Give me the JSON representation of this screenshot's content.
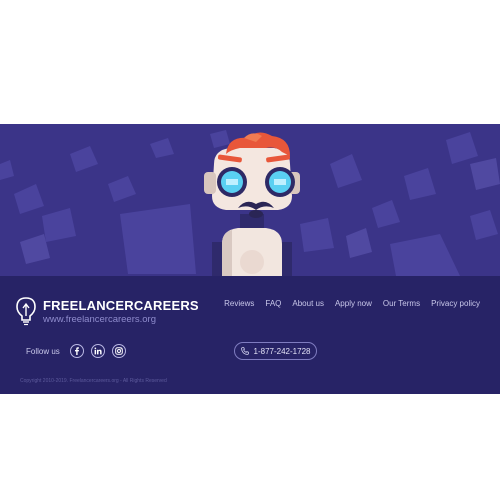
{
  "brand": {
    "name": "FREELANCERCAREERS",
    "url": "www.freelancercareers.org"
  },
  "nav": {
    "items": [
      {
        "label": "Reviews"
      },
      {
        "label": "FAQ"
      },
      {
        "label": "About us"
      },
      {
        "label": "Apply now"
      },
      {
        "label": "Our Terms"
      },
      {
        "label": "Privacy policy"
      }
    ]
  },
  "social": {
    "label": "Follow us",
    "icons": [
      "facebook-icon",
      "linkedin-icon",
      "instagram-icon"
    ]
  },
  "contact": {
    "phone": "1-877-242-1728",
    "icon": "phone-icon"
  },
  "footer": {
    "copyright": "Copyright 2010-2019. Freelancercareers.org - All Rights Reserved"
  },
  "colors": {
    "hero_bg": "#3b3488",
    "footer_bg": "#272366",
    "robot_eye": "#5ad0f2",
    "robot_hair": "#e85a3c"
  }
}
